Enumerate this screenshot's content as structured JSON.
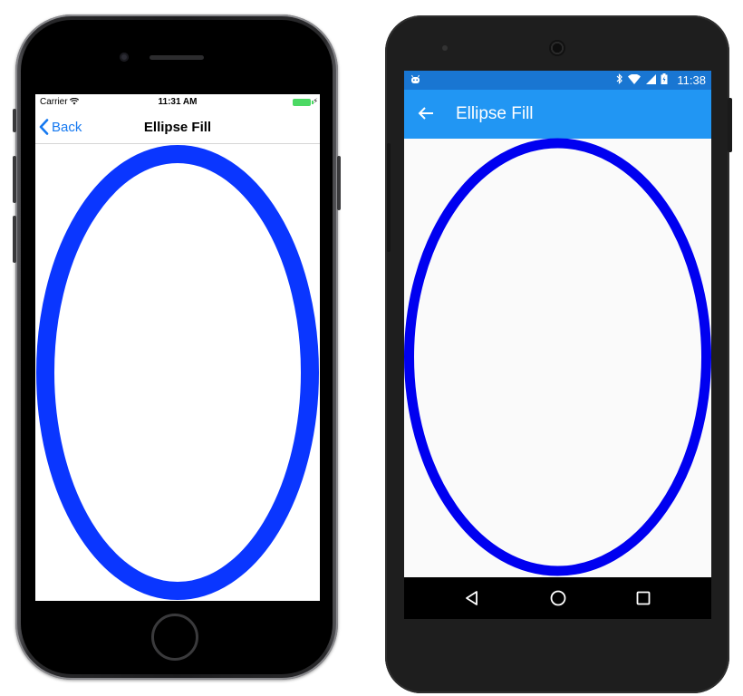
{
  "ios": {
    "status": {
      "carrier": "Carrier",
      "time": "11:31 AM"
    },
    "nav": {
      "back_label": "Back",
      "title": "Ellipse Fill"
    },
    "ellipse": {
      "stroke_color": "#0a36ff",
      "fill_color": "#ffffff"
    }
  },
  "android": {
    "status": {
      "time": "11:38"
    },
    "toolbar": {
      "title": "Ellipse Fill",
      "color": "#2196f3",
      "status_color": "#1976d2"
    },
    "ellipse": {
      "stroke_color": "#0000f0",
      "fill_color": "#fafafa"
    }
  }
}
